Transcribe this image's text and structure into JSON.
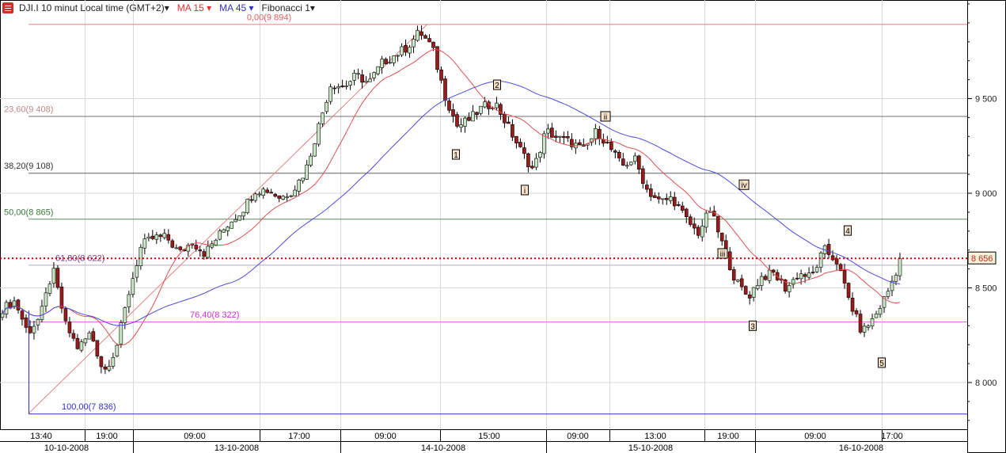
{
  "header": {
    "instrument": "DJI.I 10 minut Local time (GMT+2)▾",
    "ma15": "MA 15 ▾",
    "ma45": "MA 45 ▾",
    "fib": "Fibonacci 1▾"
  },
  "colors": {
    "up": "#c9e7c4",
    "down": "#9b1b1b",
    "ma15": "#e05050",
    "ma45": "#4b4be0",
    "price_line": "#cc0000"
  },
  "chart_data": {
    "type": "candlestick",
    "title": "DJI.I 10 minut",
    "ylim": [
      7700,
      10020
    ],
    "yticks": [
      {
        "v": 9500,
        "label": "9 500"
      },
      {
        "v": 9000,
        "label": "9 000"
      },
      {
        "v": 8500,
        "label": "8 500"
      },
      {
        "v": 8000,
        "label": "8 000"
      }
    ],
    "last_price": {
      "v": 8656,
      "label": "8 656"
    },
    "time_labels": [
      "13:40",
      "19:00",
      "09:00",
      "17:00",
      "09:00",
      "15:00",
      "09:00",
      "13:00",
      "19:00",
      "09:00",
      "17:00"
    ],
    "date_labels": [
      "10-10-2008",
      "13-10-2008",
      "14-10-2008",
      "15-10-2008",
      "16-10-2008"
    ],
    "close_path": [
      8389,
      8431,
      8264,
      8347,
      8598,
      8305,
      8180,
      8264,
      8054,
      8180,
      8473,
      8724,
      8766,
      8766,
      8682,
      8745,
      8682,
      8766,
      8849,
      8912,
      9017,
      9017,
      8975,
      9017,
      9121,
      9351,
      9582,
      9561,
      9623,
      9582,
      9686,
      9728,
      9770,
      9854,
      9770,
      9519,
      9351,
      9393,
      9456,
      9477,
      9351,
      9226,
      9121,
      9330,
      9289,
      9268,
      9226,
      9330,
      9247,
      9142,
      9184,
      9017,
      8954,
      8975,
      8870,
      8787,
      8912,
      8724,
      8536,
      8452,
      8556,
      8577,
      8494,
      8577,
      8556,
      8703,
      8640,
      8431,
      8264,
      8347,
      8473,
      8640
    ],
    "fibonacci": [
      {
        "level": "0,00",
        "v": 9894,
        "label": "0,00(9 894)",
        "color": "#e06060",
        "lineColor": "#e88080"
      },
      {
        "level": "23,60",
        "v": 9408,
        "label": "23,60(9 408)",
        "color": "#c08a8a",
        "lineColor": "#707070"
      },
      {
        "level": "38,20",
        "v": 9108,
        "label": "38,20(9 108)",
        "color": "#333333",
        "lineColor": "#606060"
      },
      {
        "level": "50,00",
        "v": 8865,
        "label": "50,00(8 865)",
        "color": "#3a7a3a",
        "lineColor": "#5a8a5a"
      },
      {
        "level": "61,80",
        "v": 8622,
        "label": "61,80(8 622)",
        "color": "#7a3a8a",
        "lineColor": "#b8a8c8"
      },
      {
        "level": "76,40",
        "v": 8322,
        "label": "76,40(8 322)",
        "color": "#d030d0",
        "lineColor": "#e070e0"
      },
      {
        "level": "100,00",
        "v": 7836,
        "label": "100,00(7 836)",
        "color": "#3030c0",
        "lineColor": "#3030c0"
      }
    ],
    "wave_labels": [
      {
        "text": "1",
        "v": 9205
      },
      {
        "text": "2",
        "v": 9573
      },
      {
        "text": "i",
        "v": 9017
      },
      {
        "text": "ii",
        "v": 9406
      },
      {
        "text": "iii",
        "v": 8682
      },
      {
        "text": "iv",
        "v": 9045
      },
      {
        "text": "3",
        "v": 8300
      },
      {
        "text": "4",
        "v": 8803
      },
      {
        "text": "5",
        "v": 8105
      }
    ]
  }
}
